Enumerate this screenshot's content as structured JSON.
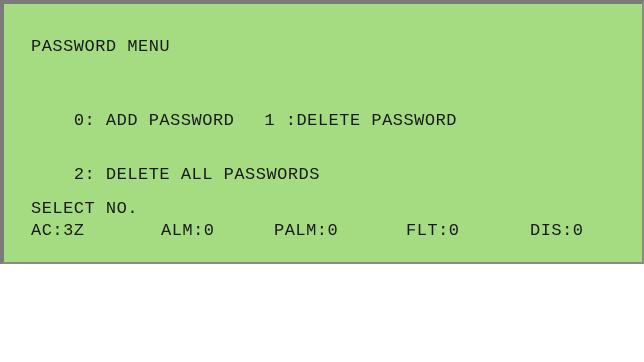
{
  "screen": {
    "title": "PASSWORD MENU",
    "options": [
      {
        "key": "0:",
        "label": "ADD PASSWORD"
      },
      {
        "key": "1 :",
        "label": "DELETE PASSWORD"
      },
      {
        "key": "2:",
        "label": "DELETE ALL PASSWORDS"
      }
    ],
    "prompt": "SELECT NO."
  },
  "status_bar": {
    "ac": "AC:3Z",
    "alm": "ALM:0",
    "palm": "PALM:0",
    "flt": "FLT:0",
    "dis": "DIS:0"
  },
  "colors": {
    "lcd_background": "#a5dc82",
    "text": "#1a1a1a",
    "bezel": "#7a7a7a"
  }
}
